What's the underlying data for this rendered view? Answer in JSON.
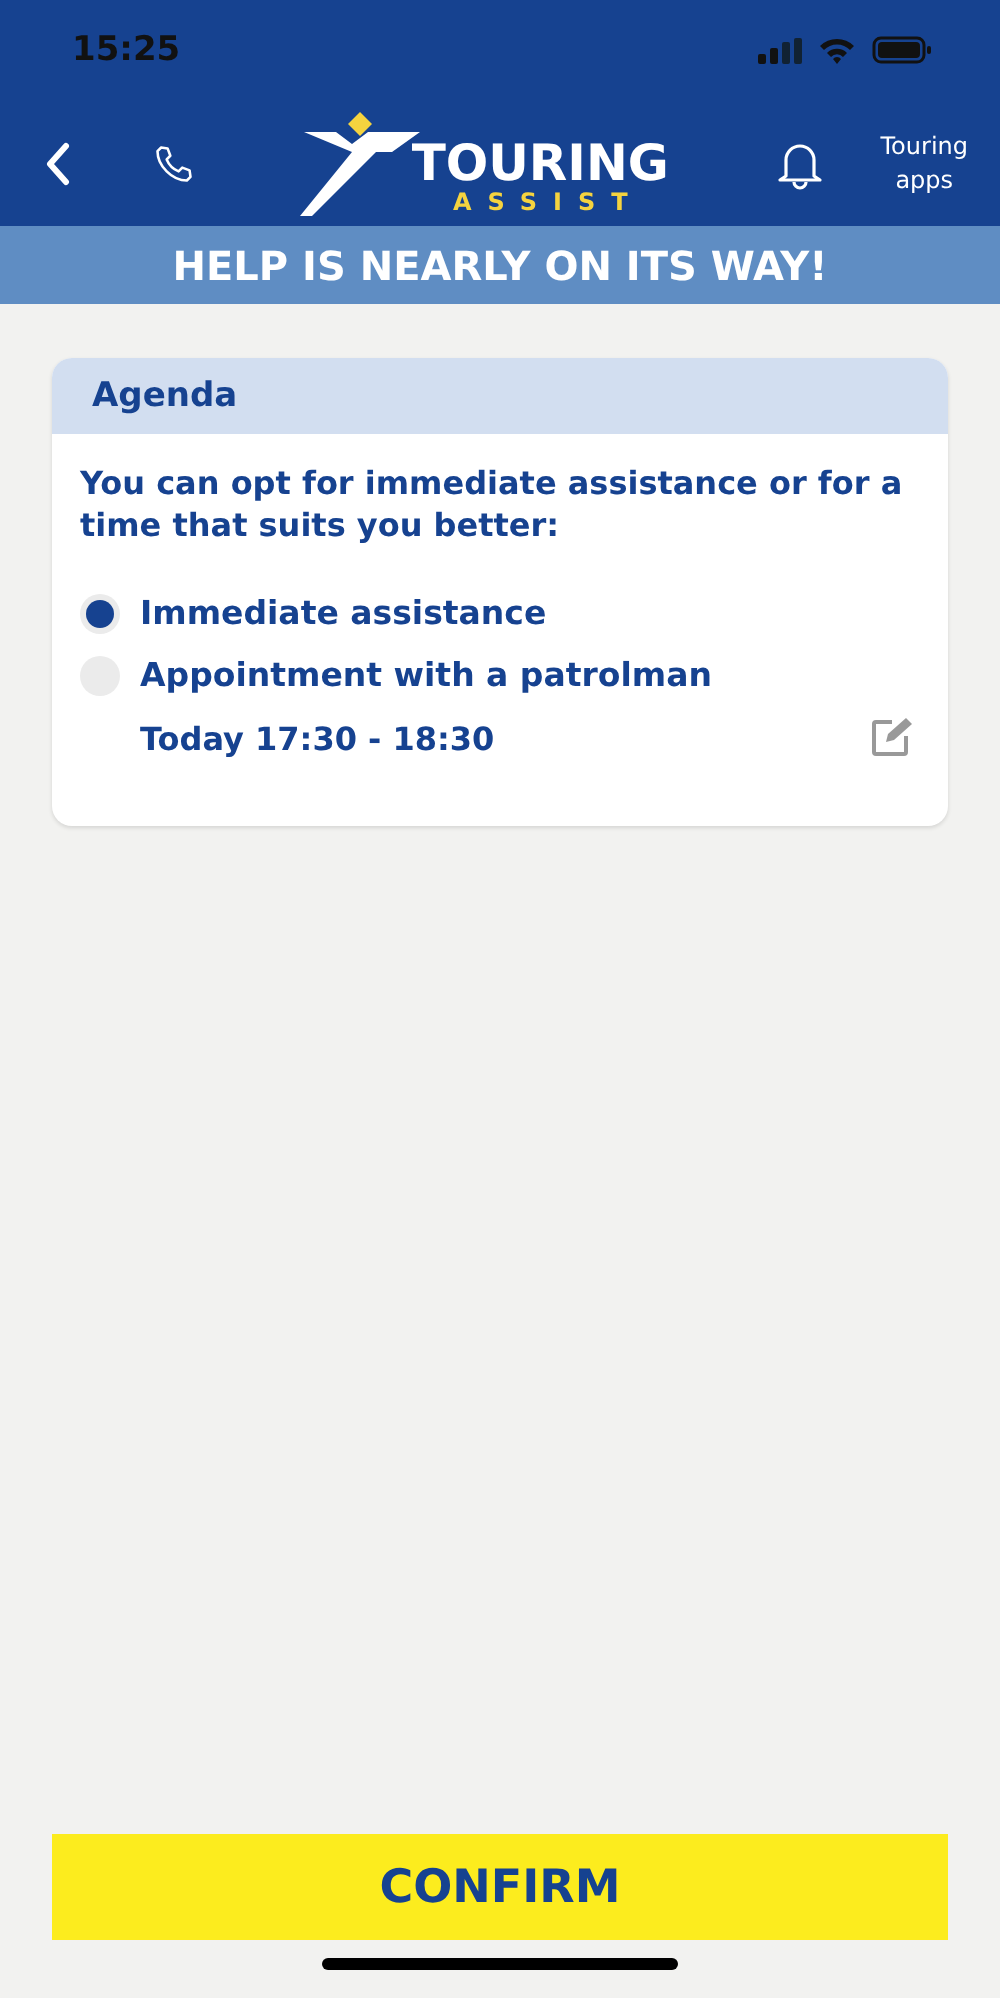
{
  "status_bar": {
    "time": "15:25"
  },
  "header": {
    "logo": {
      "name": "TOURING",
      "sub": "ASSIST"
    },
    "apps_label": [
      "Touring",
      "apps"
    ]
  },
  "banner": "HELP IS NEARLY ON ITS WAY!",
  "card": {
    "title": "Agenda",
    "intro": "You can opt for immediate assistance or for a time that suits you better:",
    "options": [
      {
        "label": "Immediate assistance",
        "selected": true
      },
      {
        "label": "Appointment with a patrolman",
        "selected": false,
        "detail": "Today 17:30 - 18:30"
      }
    ]
  },
  "confirm": "CONFIRM"
}
